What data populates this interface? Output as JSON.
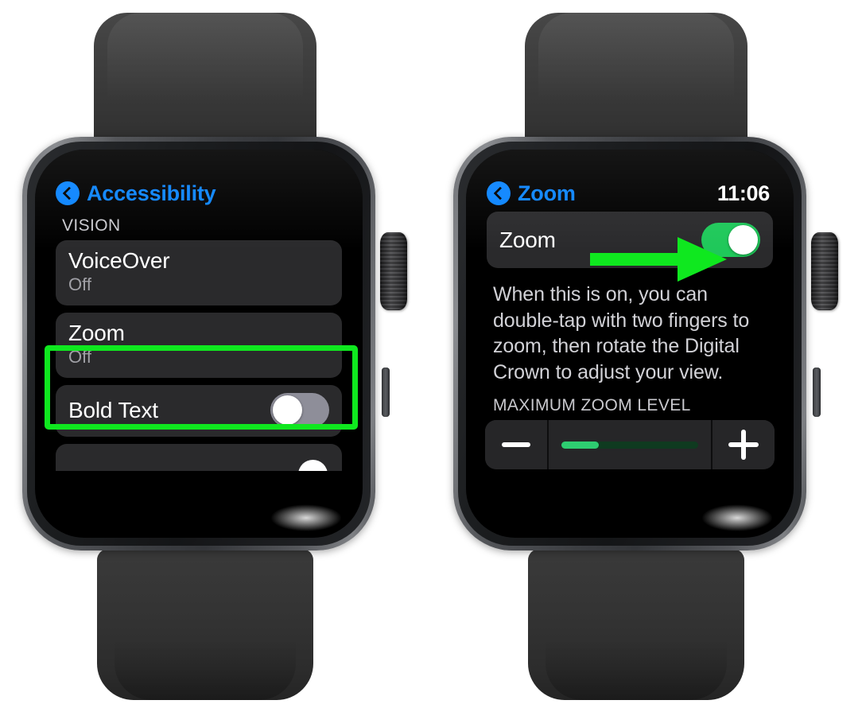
{
  "meta": {
    "accent_green": "#0fe81f",
    "accent_blue": "#0a84ff",
    "toggle_on_green": "#1fc85a",
    "toggle_off_gray": "#8e8e99",
    "slider_fill_green": "#2ecc71",
    "screen_bg": "#000000",
    "row_bg": "#2a2a2c"
  },
  "left_watch": {
    "nav": {
      "back_icon": "chevron-left-icon",
      "title": "Accessibility"
    },
    "group_header": "VISION",
    "rows": [
      {
        "title": "VoiceOver",
        "subtitle": "Off",
        "control": "none"
      },
      {
        "title": "Zoom",
        "subtitle": "Off",
        "control": "none",
        "highlighted": true
      },
      {
        "title": "Bold Text",
        "subtitle": "",
        "control": "toggle",
        "toggle_state": "off"
      }
    ]
  },
  "right_watch": {
    "nav": {
      "back_icon": "chevron-left-icon",
      "title": "Zoom",
      "time": "11:06"
    },
    "toggle_row": {
      "title": "Zoom",
      "toggle_state": "on",
      "annotation": "arrow-right-icon"
    },
    "description": "When this is on, you can double-tap with two fingers to zoom, then rotate the Digital Crown to adjust your view.",
    "zoom_level": {
      "header": "MAXIMUM ZOOM LEVEL",
      "decrease_label": "minus-icon",
      "increase_label": "plus-icon",
      "slider_percent": 27
    }
  }
}
